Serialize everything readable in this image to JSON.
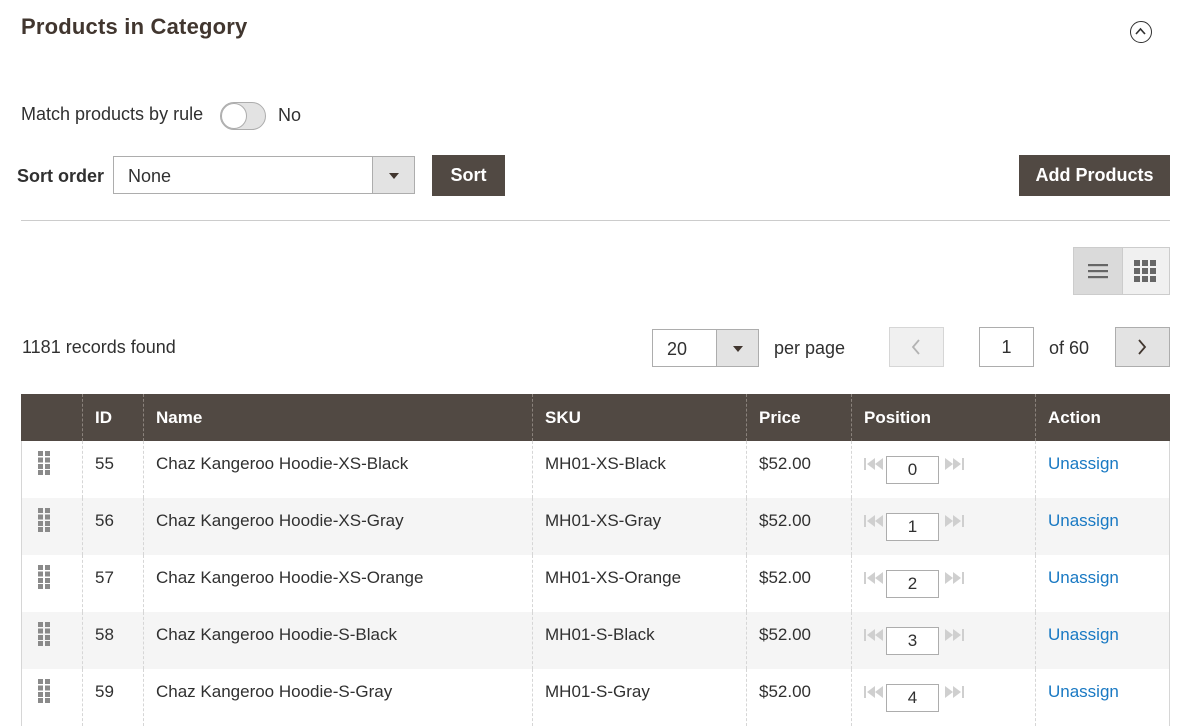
{
  "section": {
    "title": "Products in Category"
  },
  "match_rule": {
    "label": "Match products by rule",
    "value": "No"
  },
  "sort": {
    "label": "Sort order",
    "selected": "None",
    "button": "Sort"
  },
  "add_products": {
    "label": "Add Products"
  },
  "grid": {
    "records_found": "1181 records found",
    "per_page_value": "20",
    "per_page_label": "per page",
    "current_page": "1",
    "page_total": "of 60",
    "columns": [
      "ID",
      "Name",
      "SKU",
      "Price",
      "Position",
      "Action"
    ],
    "rows": [
      {
        "id": "55",
        "name": "Chaz Kangeroo Hoodie-XS-Black",
        "sku": "MH01-XS-Black",
        "price": "$52.00",
        "position": "0",
        "action": "Unassign"
      },
      {
        "id": "56",
        "name": "Chaz Kangeroo Hoodie-XS-Gray",
        "sku": "MH01-XS-Gray",
        "price": "$52.00",
        "position": "1",
        "action": "Unassign"
      },
      {
        "id": "57",
        "name": "Chaz Kangeroo Hoodie-XS-Orange",
        "sku": "MH01-XS-Orange",
        "price": "$52.00",
        "position": "2",
        "action": "Unassign"
      },
      {
        "id": "58",
        "name": "Chaz Kangeroo Hoodie-S-Black",
        "sku": "MH01-S-Black",
        "price": "$52.00",
        "position": "3",
        "action": "Unassign"
      },
      {
        "id": "59",
        "name": "Chaz Kangeroo Hoodie-S-Gray",
        "sku": "MH01-S-Gray",
        "price": "$52.00",
        "position": "4",
        "action": "Unassign"
      }
    ]
  },
  "colors": {
    "header_bg": "#514943",
    "link": "#1979c3",
    "title": "#41362f"
  },
  "icons": [
    "collapse-up-icon",
    "dropdown-caret-icon",
    "list-view-icon",
    "grid-view-icon",
    "chevron-left-icon",
    "chevron-right-icon",
    "drag-handle-icon",
    "move-to-top-icon",
    "move-to-bottom-icon"
  ]
}
